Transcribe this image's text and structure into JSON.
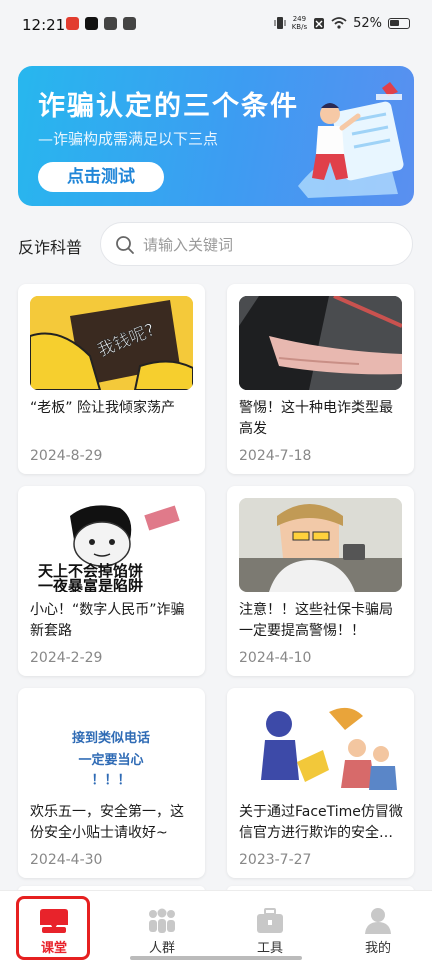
{
  "status_bar": {
    "time": "12:21",
    "net_speed_top": "249",
    "net_speed_unit": "KB/s",
    "battery_percent": "52%"
  },
  "banner": {
    "title": "诈骗认定的三个条件",
    "subtitle": "—诈骗构成需满足以下三点",
    "button_label": "点击测试"
  },
  "search": {
    "section_label": "反诈科普",
    "placeholder": "请输入关键词"
  },
  "articles": [
    {
      "title": "“老板” 险让我倾家荡产",
      "date": "2024-8-29",
      "image_caption": "我钱呢?"
    },
    {
      "title": "警惕！这十种电诈类型最高发",
      "date": "2024-7-18"
    },
    {
      "title": "小心！“数字人民币”诈骗新套路",
      "date": "2024-2-29",
      "image_caption_line1": "天上不会掉馅饼",
      "image_caption_line2": "一夜暴富是陷阱"
    },
    {
      "title": "注意！！这些社保卡骗局一定要提高警惕！！",
      "date": "2024-4-10"
    },
    {
      "title": "欢乐五一，安全第一，这份安全小贴士请收好~",
      "date": "2024-4-30",
      "image_caption_line1": "接到类似电话",
      "image_caption_line2": "一定要当心",
      "image_caption_line3": "！！！"
    },
    {
      "title": "关于通过FaceTime仿冒微信官方进行欺诈的安全提示",
      "date": "2023-7-27"
    }
  ],
  "tabbar": {
    "tabs": [
      {
        "label": "课堂",
        "icon": "classroom-icon",
        "active": true
      },
      {
        "label": "人群",
        "icon": "people-icon",
        "active": false
      },
      {
        "label": "工具",
        "icon": "toolbox-icon",
        "active": false
      },
      {
        "label": "我的",
        "icon": "profile-icon",
        "active": false
      }
    ]
  },
  "colors": {
    "accent_red": "#e8232b",
    "banner_blue": "#3d9cf2",
    "button_text_blue": "#2186d8"
  }
}
